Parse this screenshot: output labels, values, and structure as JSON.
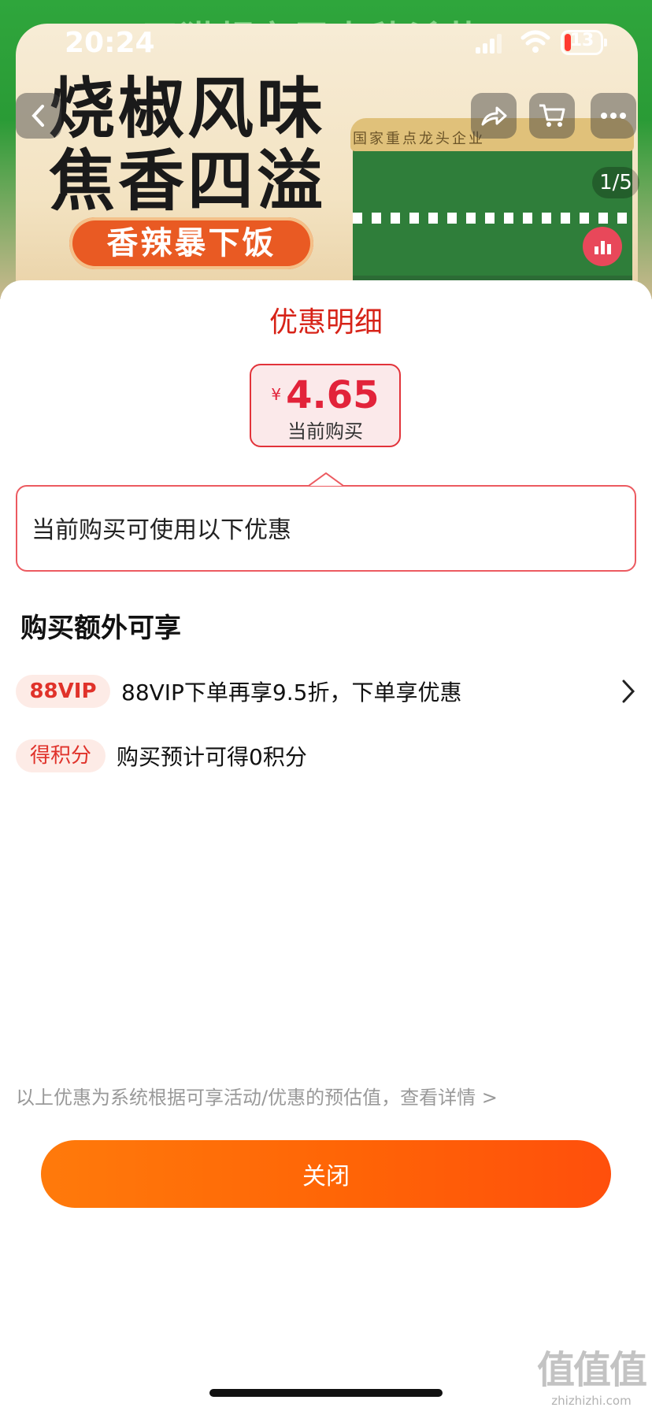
{
  "status_bar": {
    "time": "20:24",
    "battery": "13"
  },
  "product_banner": {
    "promo": "天猫超市周末秒杀节",
    "headline_line1": "烧椒风味",
    "headline_line2": "焦香四溢",
    "tagline": "香辣暴下饭",
    "jar_label": "国家重点龙头企业",
    "image_counter": "1/5"
  },
  "nav": {
    "back_icon": "chevron-left-icon",
    "share_icon": "share-icon",
    "cart_icon": "cart-icon",
    "more_icon": "more-dots-icon"
  },
  "sheet": {
    "title": "优惠明细",
    "price": {
      "currency": "¥",
      "amount": "4.65",
      "caption": "当前购买"
    },
    "tip": "当前购买可使用以下优惠",
    "extra_section_title": "购买额外可享",
    "perks": [
      {
        "tag": "88VIP",
        "text": "88VIP下单再享9.5折，下单享优惠"
      },
      {
        "tag": "得积分",
        "text": "购买预计可得0积分"
      }
    ],
    "disclaimer": "以上优惠为系统根据可享活动/优惠的预估值，查看详情 >",
    "close_label": "关闭"
  },
  "watermark": {
    "big": "值值值",
    "small": "zhizhizhi.com"
  },
  "colors": {
    "accent_red": "#e2233a",
    "button_orange": "#ff6406",
    "tag_bg": "#fdebe6"
  }
}
